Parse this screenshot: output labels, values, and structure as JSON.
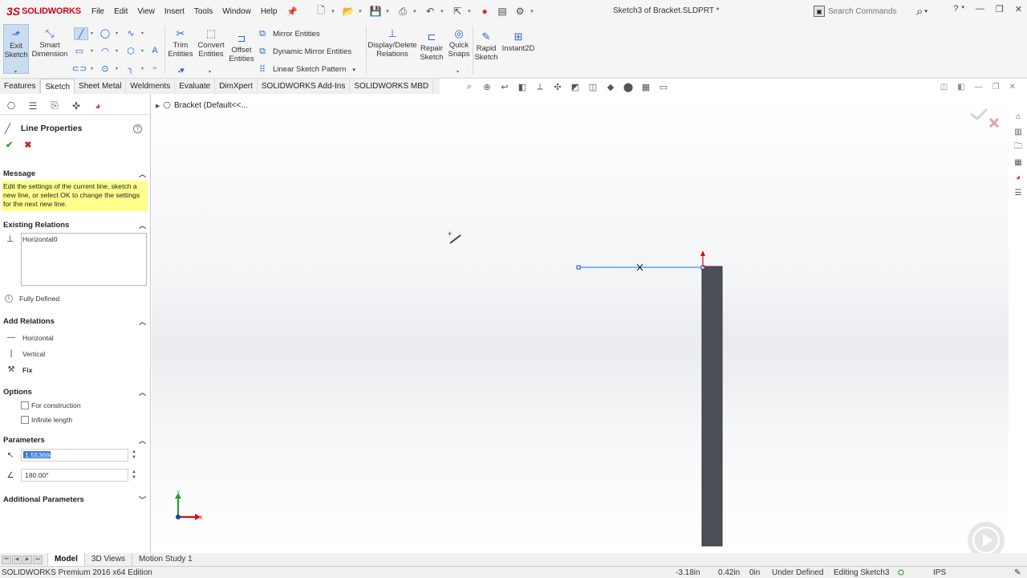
{
  "app": {
    "brand_ds": "3S",
    "brand_name": "SOLIDWORKS",
    "menus": [
      "File",
      "Edit",
      "View",
      "Insert",
      "Tools",
      "Window",
      "Help"
    ],
    "document_title": "Sketch3 of Bracket.SLDPRT *",
    "search_placeholder": "Search Commands"
  },
  "command_manager": {
    "exit_sketch": "Exit\nSketch",
    "smart_dimension": "Smart\nDimension",
    "trim_entities": "Trim\nEntities",
    "convert_entities": "Convert\nEntities",
    "offset_entities": "Offset\nEntities",
    "mirror_entities": "Mirror Entities",
    "dynamic_mirror": "Dynamic Mirror Entities",
    "linear_pattern": "Linear Sketch Pattern",
    "display_delete_relations": "Display/Delete\nRelations",
    "repair_sketch": "Repair\nSketch",
    "quick_snaps": "Quick\nSnaps",
    "rapid_sketch": "Rapid\nSketch",
    "instant2d": "Instant2D"
  },
  "tabs": [
    "Features",
    "Sketch",
    "Sheet Metal",
    "Weldments",
    "Evaluate",
    "DimXpert",
    "SOLIDWORKS Add-Ins",
    "SOLIDWORKS MBD"
  ],
  "active_tab": "Sketch",
  "property_manager": {
    "title": "Line Properties",
    "message_header": "Message",
    "message_text": "Edit the settings of the current line, sketch a new line, or select OK to change the settings for the next new line.",
    "existing_relations_header": "Existing Relations",
    "existing_relations": [
      "Horizontal0"
    ],
    "status": "Fully Defined",
    "add_relations_header": "Add Relations",
    "add_relations": [
      "Horizontal",
      "Vertical",
      "Fix"
    ],
    "options_header": "Options",
    "options": [
      "For construction",
      "Infinite length"
    ],
    "parameters_header": "Parameters",
    "length_value": "1.553694",
    "angle_value": "180.00°",
    "additional_parameters_header": "Additional Parameters"
  },
  "feature_tree": {
    "item": "Bracket  (Default<<..."
  },
  "triad": {
    "x_label": "X",
    "y_label": "Y"
  },
  "bottom_tabs": [
    "Model",
    "3D Views",
    "Motion Study 1"
  ],
  "active_bottom_tab": "Model",
  "status_bar": {
    "edition": "SOLIDWORKS Premium 2016 x64 Edition",
    "x_coord": "-3.18in",
    "y_coord": "0.42in",
    "z_coord": "0in",
    "definition": "Under Defined",
    "editing": "Editing Sketch3",
    "units": "IPS"
  },
  "colors": {
    "brand_red": "#d0021b",
    "message_yellow": "#ffff8c",
    "sketch_line": "#3a8ee6",
    "part_body": "#4b4f58",
    "accent_blue": "#2a62c9"
  }
}
